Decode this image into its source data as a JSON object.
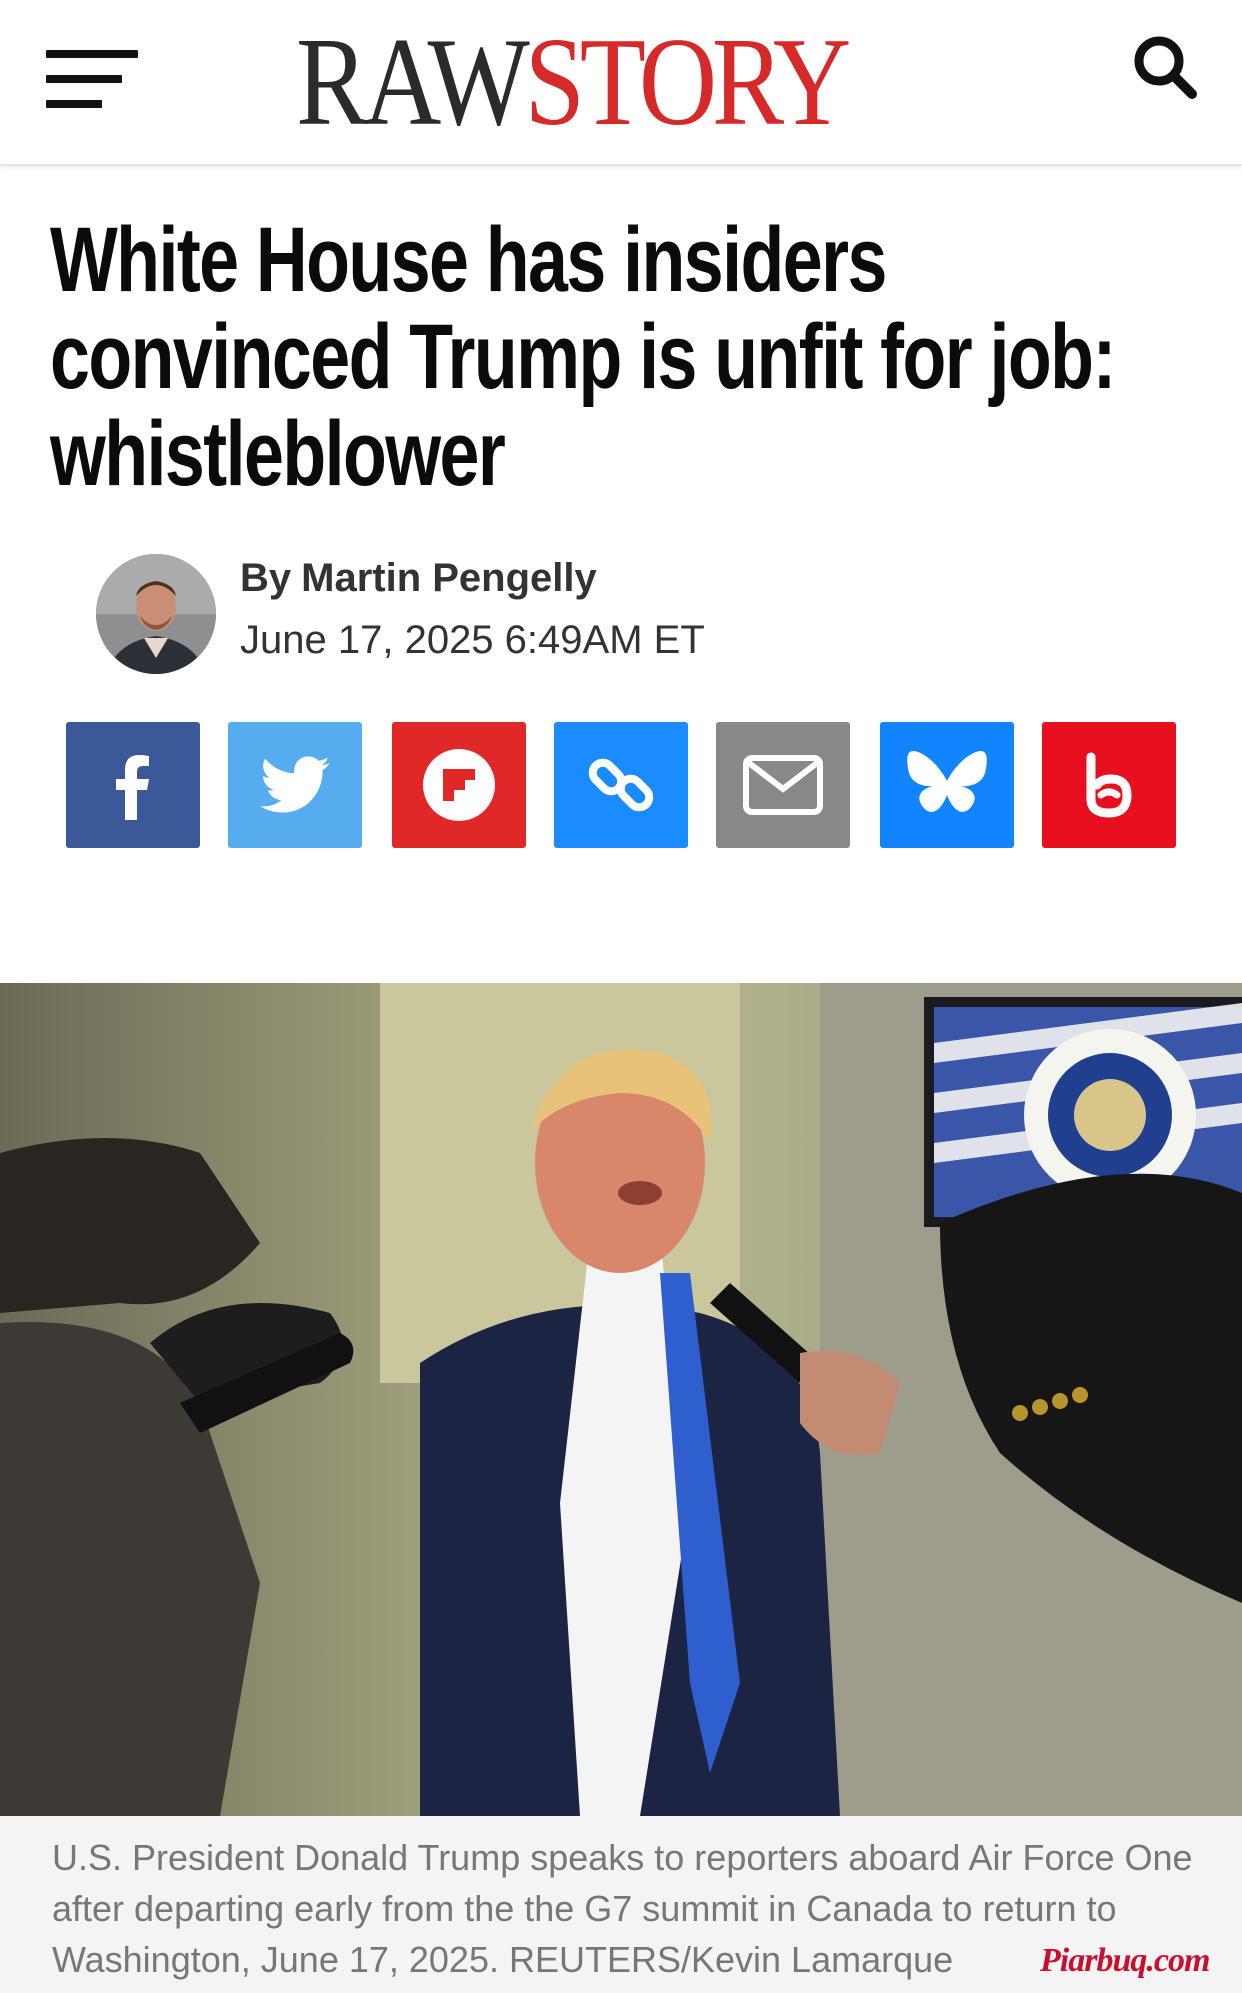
{
  "header": {
    "logo_raw": "RAW",
    "logo_story": "STORY",
    "menu_icon": "hamburger-menu-icon",
    "search_icon": "search-icon"
  },
  "article": {
    "headline": "White House has insiders convinced Trump is unfit for job: whistleblower",
    "byline_prefix": "By",
    "author": "Martin Pengelly",
    "date": "June 17, 2025 6:49AM ET"
  },
  "share": [
    {
      "name": "facebook",
      "icon": "facebook-icon",
      "color": "#3b5998"
    },
    {
      "name": "twitter",
      "icon": "twitter-icon",
      "color": "#55acee"
    },
    {
      "name": "flipboard",
      "icon": "flipboard-icon",
      "color": "#e12828"
    },
    {
      "name": "copy-link",
      "icon": "link-icon",
      "color": "#1a8cff"
    },
    {
      "name": "email",
      "icon": "email-icon",
      "color": "#888888"
    },
    {
      "name": "bluesky",
      "icon": "bluesky-icon",
      "color": "#1185fe"
    },
    {
      "name": "raw-social",
      "icon": "raw-b-icon",
      "color": "#e8101e"
    }
  ],
  "photo": {
    "caption": "U.S. President Donald Trump speaks to reporters aboard Air Force One after departing early from the the G7 summit in Canada to return to Washington, June 17, 2025. REUTERS/Kevin Lamarque",
    "watermark": "Piarbuq.com"
  },
  "colors": {
    "brand_red": "#d62a2a",
    "brand_dark": "#2b2b2b"
  }
}
